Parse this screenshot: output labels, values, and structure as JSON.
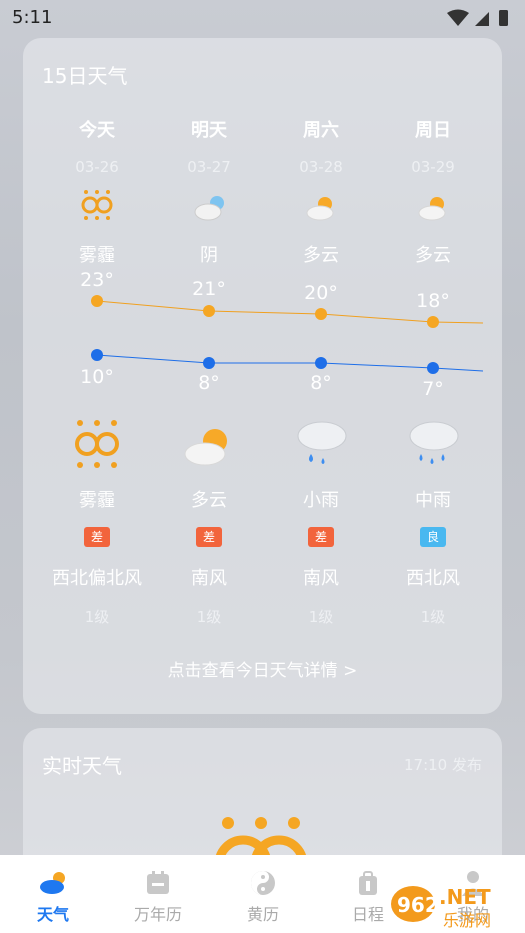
{
  "status": {
    "time": "5:11"
  },
  "forecast": {
    "title": "15日天气",
    "days": [
      {
        "day": "今天",
        "date": "03-26",
        "cond": "雾霾",
        "high": "23°",
        "low": "10°",
        "cond2": "雾霾",
        "aqi": "差",
        "aqi_color": "#f2643c",
        "wind": "西北偏北风",
        "level": "1级"
      },
      {
        "day": "明天",
        "date": "03-27",
        "cond": "阴",
        "high": "21°",
        "low": "8°",
        "cond2": "多云",
        "aqi": "差",
        "aqi_color": "#f2643c",
        "wind": "南风",
        "level": "1级"
      },
      {
        "day": "周六",
        "date": "03-28",
        "cond": "多云",
        "high": "20°",
        "low": "8°",
        "cond2": "小雨",
        "aqi": "差",
        "aqi_color": "#f2643c",
        "wind": "南风",
        "level": "1级"
      },
      {
        "day": "周日",
        "date": "03-29",
        "cond": "多云",
        "high": "18°",
        "low": "7°",
        "cond2": "中雨",
        "aqi": "良",
        "aqi_color": "#49b8f0",
        "wind": "西北风",
        "level": "1级"
      }
    ],
    "detail_link": "点击查看今日天气详情 >"
  },
  "realtime": {
    "title": "实时天气",
    "publish": "17:10 发布"
  },
  "tabs": [
    {
      "label": "天气",
      "icon": "weather-cloud-icon",
      "active": true
    },
    {
      "label": "万年历",
      "icon": "calendar-icon",
      "active": false
    },
    {
      "label": "黄历",
      "icon": "yin-yang-icon",
      "active": false
    },
    {
      "label": "日程",
      "icon": "schedule-icon",
      "active": false
    },
    {
      "label": "我的",
      "icon": "user-icon",
      "active": false
    }
  ],
  "watermark": {
    "brand": "962",
    "suffix": ".NET",
    "sub": "乐游网"
  },
  "colors": {
    "accent": "#1e78f0",
    "high_line": "#f5a623",
    "low_line": "#1e6ee8"
  }
}
